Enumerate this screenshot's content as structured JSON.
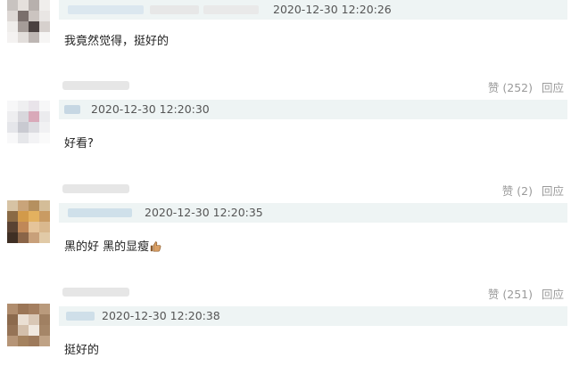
{
  "comments": [
    {
      "timestamp": "2020-12-30 12:20:26",
      "text": "我竟然觉得，挺好的",
      "like_label": "赞 (252)",
      "reply_label": "回应"
    },
    {
      "timestamp": "2020-12-30 12:20:30",
      "text": "好看?",
      "like_label": "赞 (2)",
      "reply_label": "回应"
    },
    {
      "timestamp": "2020-12-30 12:20:35",
      "text": "黑的好 黑的显瘦",
      "emoji": "thumbs-up-icon",
      "like_label": "赞 (251)",
      "reply_label": "回应"
    },
    {
      "timestamp": "2020-12-30 12:20:38",
      "text": "挺好的"
    }
  ],
  "colors": {
    "meta_bar": "#eef4f4",
    "action_text": "#9a9a9a",
    "blurred_name": "#dde8f0"
  }
}
